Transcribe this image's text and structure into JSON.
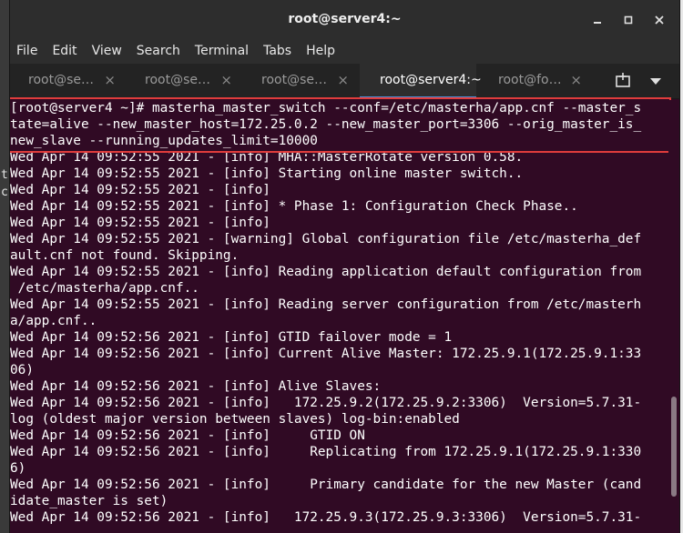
{
  "window": {
    "title": "root@server4:~",
    "controls": {
      "minimize": "minimize-icon",
      "maximize": "maximize-icon",
      "close": "close-icon"
    }
  },
  "menu": [
    "File",
    "Edit",
    "View",
    "Search",
    "Terminal",
    "Tabs",
    "Help"
  ],
  "tabs": [
    {
      "label": "root@se…",
      "active": false
    },
    {
      "label": "root@se…",
      "active": false
    },
    {
      "label": "root@se…",
      "active": false
    },
    {
      "label": "root@server4:~",
      "active": true
    },
    {
      "label": "root@fo…",
      "active": false
    }
  ],
  "tab_icons": {
    "new_tab": "new-tab-icon",
    "tabs_menu": "chevron-down-icon"
  },
  "background": {
    "left_fragments": [
      "t",
      "c"
    ],
    "right_fragment": "×"
  },
  "colors": {
    "terminal_bg": "#300a24",
    "highlight": "#e03c3c",
    "accent": "#4a90d9"
  },
  "terminal": {
    "lines": [
      "[root@server4 ~]# masterha_master_switch --conf=/etc/masterha/app.cnf --master_s",
      "tate=alive --new_master_host=172.25.0.2 --new_master_port=3306 --orig_master_is_",
      "new_slave --running_updates_limit=10000",
      "Wed Apr 14 09:52:55 2021 - [info] MHA::MasterRotate version 0.58.",
      "Wed Apr 14 09:52:55 2021 - [info] Starting online master switch..",
      "Wed Apr 14 09:52:55 2021 - [info]",
      "Wed Apr 14 09:52:55 2021 - [info] * Phase 1: Configuration Check Phase..",
      "Wed Apr 14 09:52:55 2021 - [info]",
      "Wed Apr 14 09:52:55 2021 - [warning] Global configuration file /etc/masterha_def",
      "ault.cnf not found. Skipping.",
      "Wed Apr 14 09:52:55 2021 - [info] Reading application default configuration from",
      " /etc/masterha/app.cnf..",
      "Wed Apr 14 09:52:55 2021 - [info] Reading server configuration from /etc/masterh",
      "a/app.cnf..",
      "Wed Apr 14 09:52:56 2021 - [info] GTID failover mode = 1",
      "Wed Apr 14 09:52:56 2021 - [info] Current Alive Master: 172.25.9.1(172.25.9.1:33",
      "06)",
      "Wed Apr 14 09:52:56 2021 - [info] Alive Slaves:",
      "Wed Apr 14 09:52:56 2021 - [info]   172.25.9.2(172.25.9.2:3306)  Version=5.7.31-",
      "log (oldest major version between slaves) log-bin:enabled",
      "Wed Apr 14 09:52:56 2021 - [info]     GTID ON",
      "Wed Apr 14 09:52:56 2021 - [info]     Replicating from 172.25.9.1(172.25.9.1:330",
      "6)",
      "Wed Apr 14 09:52:56 2021 - [info]     Primary candidate for the new Master (cand",
      "idate_master is set)",
      "Wed Apr 14 09:52:56 2021 - [info]   172.25.9.3(172.25.9.3:3306)  Version=5.7.31-"
    ]
  }
}
